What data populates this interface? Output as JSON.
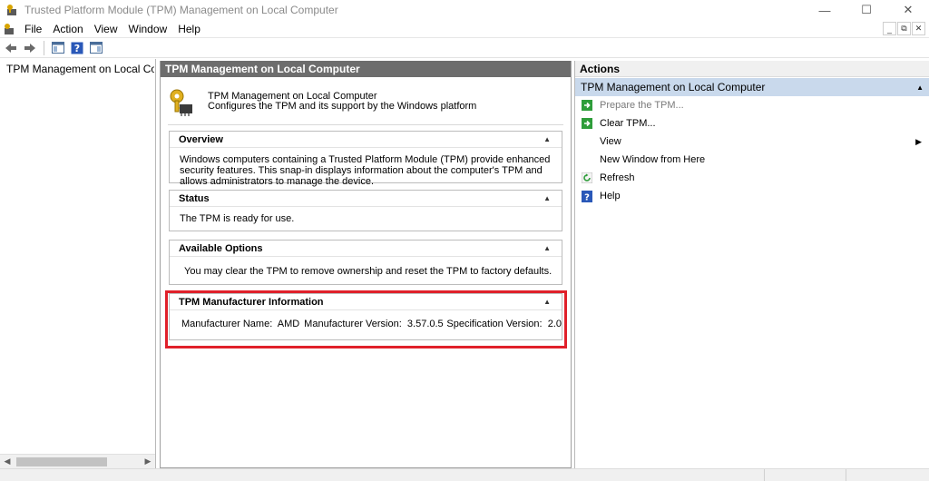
{
  "window": {
    "title": "Trusted Platform Module (TPM) Management on Local Computer",
    "minimize": "—",
    "maximize": "☐",
    "close": "✕"
  },
  "menu": [
    "File",
    "Action",
    "View",
    "Window",
    "Help"
  ],
  "mdi_controls": [
    "_",
    "⧉",
    "✕"
  ],
  "tree": {
    "item_label": "TPM Management on Local Comp"
  },
  "main": {
    "header": "TPM Management on Local Computer",
    "snapin_title": "TPM Management on Local Computer",
    "snapin_subtitle": "Configures the TPM and its support by the Windows platform",
    "sections": {
      "overview": {
        "title": "Overview",
        "body": "Windows computers containing a Trusted Platform Module (TPM) provide enhanced security features. This snap-in displays information about the computer's TPM and allows administrators to manage the device."
      },
      "status": {
        "title": "Status",
        "body": "The TPM is ready for use."
      },
      "options": {
        "title": "Available Options",
        "body": "You may clear the TPM to remove ownership and reset the TPM to factory defaults."
      },
      "manufacturer": {
        "title": "TPM Manufacturer Information",
        "name_label": "Manufacturer Name:",
        "name_value": "AMD",
        "version_label": "Manufacturer Version:",
        "version_value": "3.57.0.5",
        "spec_label": "Specification Version:",
        "spec_value": "2.0"
      }
    },
    "collapse_glyph": "▲"
  },
  "actions": {
    "header": "Actions",
    "subheader": "TPM Management on Local Computer",
    "items": [
      {
        "label": "Prepare the TPM...",
        "icon": "green-arrow-icon",
        "disabled": true
      },
      {
        "label": "Clear TPM...",
        "icon": "green-arrow-icon",
        "disabled": false
      },
      {
        "label": "View",
        "icon": "",
        "disabled": false,
        "submenu": true
      },
      {
        "label": "New Window from Here",
        "icon": "",
        "disabled": false
      },
      {
        "label": "Refresh",
        "icon": "refresh-icon",
        "disabled": false
      },
      {
        "label": "Help",
        "icon": "help-icon",
        "disabled": false
      }
    ],
    "submenu_glyph": "▶"
  },
  "colors": {
    "highlight": "#e0202a",
    "main_header_bg": "#6d6d6d",
    "actions_sub_bg": "#c9d9ec",
    "action_icon_green": "#2e9d3a"
  }
}
